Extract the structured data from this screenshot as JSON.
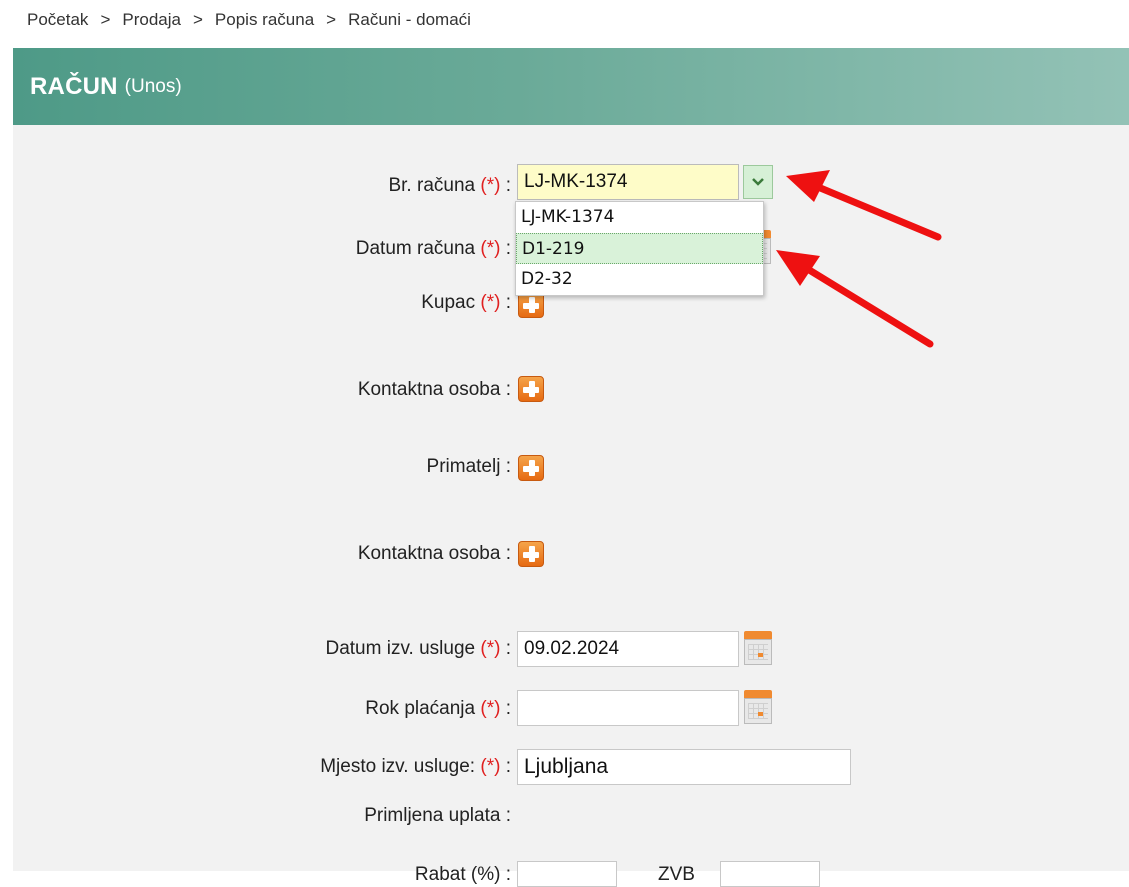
{
  "breadcrumb": {
    "items": [
      "Početak",
      "Prodaja",
      "Popis računa",
      "Računi - domaći"
    ],
    "separator": ">"
  },
  "header": {
    "title": "RAČUN",
    "mode": "(Unos)"
  },
  "required_mark": "(*)",
  "form": {
    "invoice_no": {
      "label": "Br. računa",
      "value": "LJ-MK-1374"
    },
    "invoice_no_options": [
      "LJ-MK-1374",
      "D1-219",
      "D2-32"
    ],
    "invoice_date": {
      "label": "Datum računa"
    },
    "buyer": {
      "label": "Kupac"
    },
    "buyer_contact": {
      "label": "Kontaktna osoba"
    },
    "recipient": {
      "label": "Primatelj"
    },
    "recipient_contact": {
      "label": "Kontaktna osoba"
    },
    "service_date": {
      "label": "Datum izv. usluge",
      "value": "09.02.2024"
    },
    "payment_due": {
      "label": "Rok plaćanja",
      "value": ""
    },
    "service_place": {
      "label": "Mjesto izv. usluge:",
      "value": "Ljubljana"
    },
    "payment_received": {
      "label": "Primljena uplata"
    },
    "discount": {
      "label": "Rabat (%)"
    },
    "vat": {
      "label": "ZVB"
    }
  },
  "colors": {
    "header_start": "#4e9a87",
    "header_end": "#93c2b6",
    "required": "#e02020",
    "arrow": "#ee1111"
  }
}
